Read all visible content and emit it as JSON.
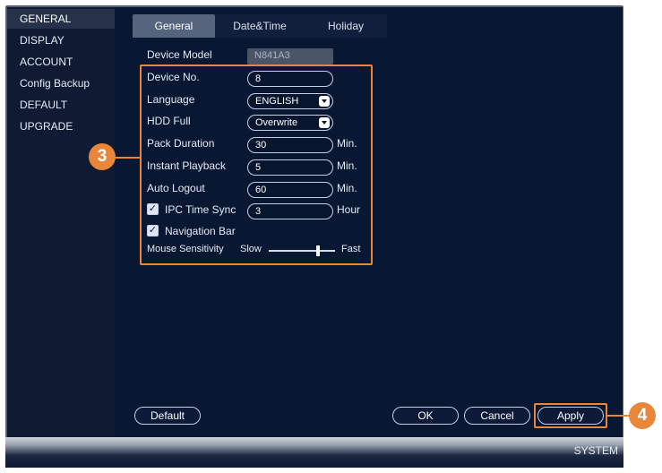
{
  "sidebar": {
    "items": [
      {
        "label": "GENERAL",
        "active": true
      },
      {
        "label": "DISPLAY"
      },
      {
        "label": "ACCOUNT"
      },
      {
        "label": "Config Backup"
      },
      {
        "label": "DEFAULT"
      },
      {
        "label": "UPGRADE"
      }
    ]
  },
  "tabs": [
    {
      "label": "General",
      "active": true
    },
    {
      "label": "Date&Time"
    },
    {
      "label": "Holiday"
    }
  ],
  "form": {
    "device_model": {
      "label": "Device Model",
      "value": "N841A3"
    },
    "device_no": {
      "label": "Device No.",
      "value": "8"
    },
    "language": {
      "label": "Language",
      "value": "ENGLISH"
    },
    "hdd_full": {
      "label": "HDD Full",
      "value": "Overwrite"
    },
    "pack_duration": {
      "label": "Pack Duration",
      "value": "30",
      "unit": "Min."
    },
    "instant_playback": {
      "label": "Instant Playback",
      "value": "5",
      "unit": "Min."
    },
    "auto_logout": {
      "label": "Auto Logout",
      "value": "60",
      "unit": "Min."
    },
    "ipc_time_sync": {
      "label": "IPC Time Sync",
      "value": "3",
      "unit": "Hour",
      "checked": true
    },
    "navigation_bar": {
      "label": "Navigation Bar",
      "checked": true
    },
    "mouse_sensitivity": {
      "label": "Mouse Sensitivity",
      "slow": "Slow",
      "fast": "Fast",
      "level": 0.75
    }
  },
  "buttons": {
    "default": "Default",
    "ok": "OK",
    "cancel": "Cancel",
    "apply": "Apply"
  },
  "footer": {
    "label": "SYSTEM"
  },
  "callouts": {
    "settings": "3",
    "apply": "4"
  },
  "colors": {
    "accent": "#e8873a",
    "panel": "#081732",
    "sidebar": "#0f1b33"
  },
  "icons": {
    "check": "check-icon",
    "caret": "chevron-down-icon"
  }
}
